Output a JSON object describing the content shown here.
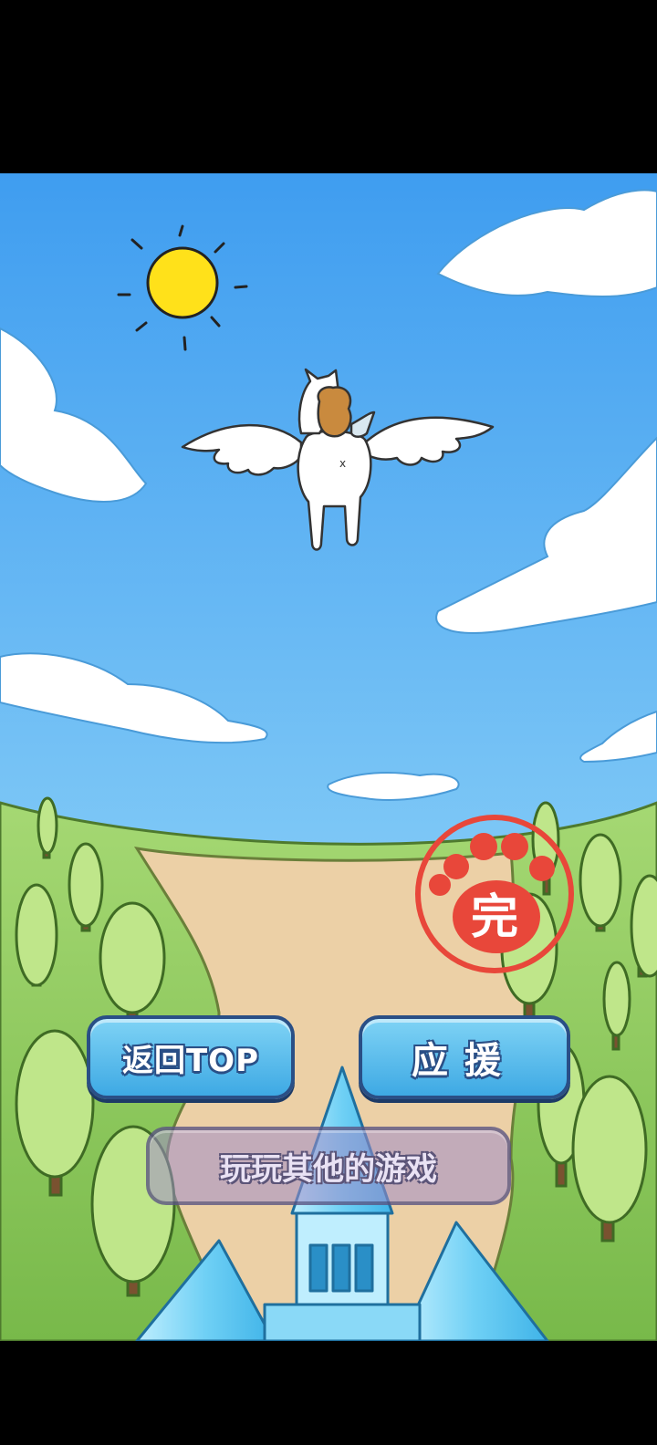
{
  "buttons": {
    "back_to_top": "返回TOP",
    "support": "应援",
    "play_other_games": "玩玩其他的游戏"
  },
  "stamp": {
    "label": "完",
    "color": "#e8473a"
  },
  "colors": {
    "sky": "#5bb6f2",
    "grass": "#8cc75a",
    "path": "#e9c9a0",
    "button": "#3ea9e4"
  }
}
